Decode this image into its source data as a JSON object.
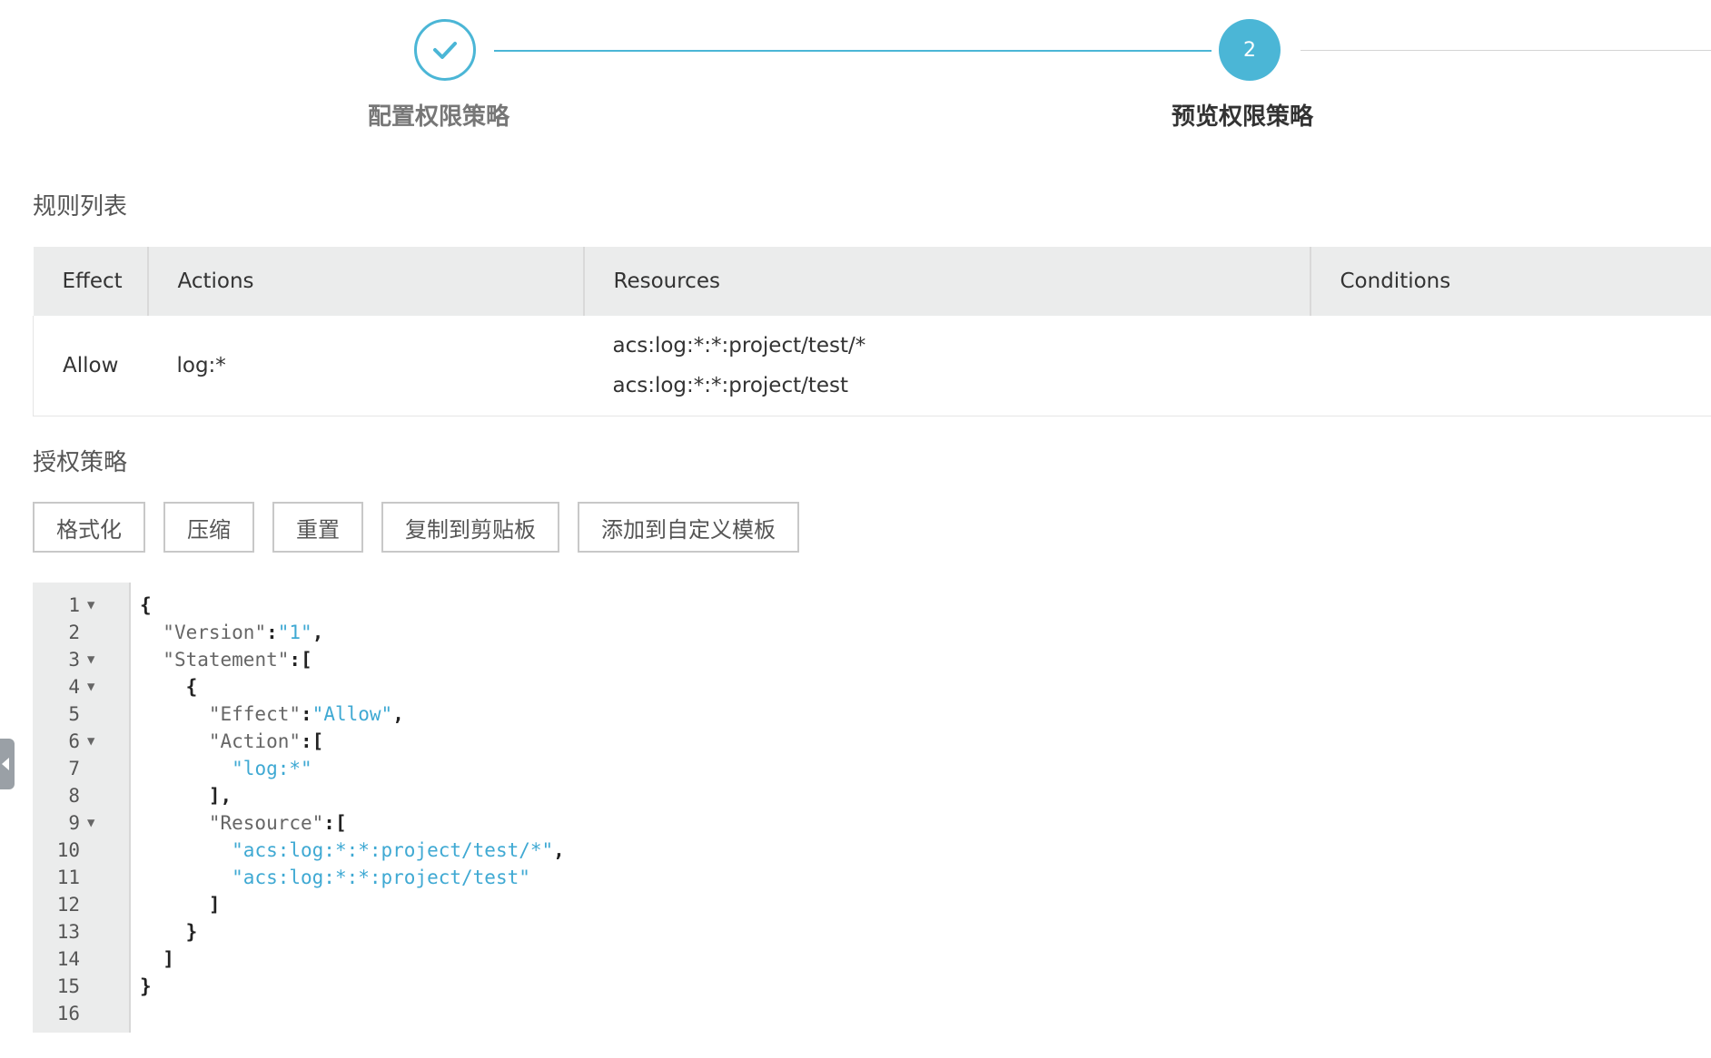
{
  "stepper": {
    "steps": [
      {
        "label": "配置权限策略",
        "state": "done"
      },
      {
        "label": "预览权限策略",
        "state": "active",
        "number": "2"
      }
    ],
    "accent_color": "#4bb6d6"
  },
  "rules": {
    "title": "规则列表",
    "columns": [
      "Effect",
      "Actions",
      "Resources",
      "Conditions"
    ],
    "rows": [
      {
        "effect": "Allow",
        "actions": "log:*",
        "resources": [
          "acs:log:*:*:project/test/*",
          "acs:log:*:*:project/test"
        ],
        "conditions": ""
      }
    ]
  },
  "policy": {
    "title": "授权策略",
    "buttons": [
      "格式化",
      "压缩",
      "重置",
      "复制到剪贴板",
      "添加到自定义模板"
    ]
  },
  "editor": {
    "line_numbers": [
      "1",
      "2",
      "3",
      "4",
      "5",
      "6",
      "7",
      "8",
      "9",
      "10",
      "11",
      "12",
      "13",
      "14",
      "15",
      "16"
    ],
    "fold_lines": [
      1,
      3,
      4,
      6,
      9
    ],
    "tokens": {
      "version_key": "\"Version\"",
      "version_val": "\"1\"",
      "statement_key": "\"Statement\"",
      "effect_key": "\"Effect\"",
      "effect_val": "\"Allow\"",
      "action_key": "\"Action\"",
      "action_val": "\"log:*\"",
      "resource_key": "\"Resource\"",
      "resource_val_1": "\"acs:log:*:*:project/test/*\"",
      "resource_val_2": "\"acs:log:*:*:project/test\""
    },
    "string_color": "#3fa9d3"
  }
}
